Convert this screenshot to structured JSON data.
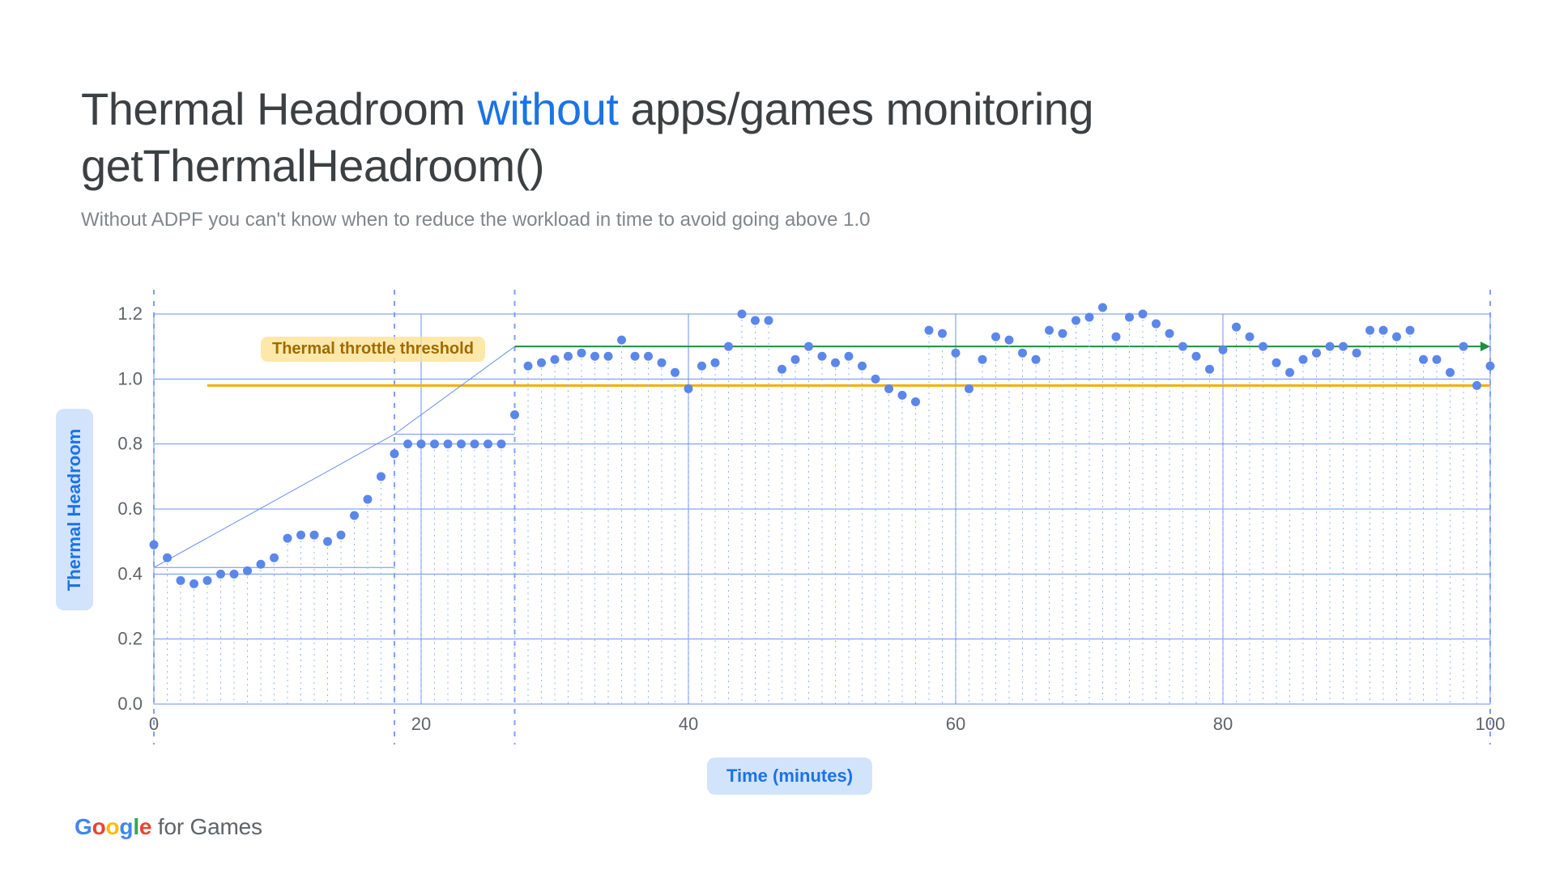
{
  "title": {
    "pre": "Thermal Headroom ",
    "accent": "without",
    "post": " apps/games monitoring getThermalHeadroom()"
  },
  "subtitle": "Without ADPF you can't know when to reduce the workload in time to avoid going above 1.0",
  "ylabel": "Thermal Headroom",
  "xlabel": "Time (minutes)",
  "annotation": "Thermal throttle threshold",
  "footer": {
    "logo": [
      "G",
      "o",
      "o",
      "g",
      "l",
      "e"
    ],
    "rest": " for Games"
  },
  "chart_data": {
    "type": "scatter",
    "title": "",
    "xlabel": "Time (minutes)",
    "ylabel": "Thermal Headroom",
    "xlim": [
      0,
      100
    ],
    "ylim": [
      0.0,
      1.2
    ],
    "x_ticks": [
      0,
      20,
      40,
      60,
      80,
      100
    ],
    "y_ticks": [
      0.0,
      0.2,
      0.4,
      0.6,
      0.8,
      1.0,
      1.2
    ],
    "threshold_line_y": 0.98,
    "plateau_arrow_y": 1.1,
    "dashed_vlines_x": [
      0,
      18,
      27,
      100
    ],
    "segment_brackets": [
      {
        "x0": 0,
        "x1": 18,
        "y": 0.42
      },
      {
        "x0": 18,
        "x1": 27,
        "y": 0.83
      }
    ],
    "x": [
      0,
      1,
      2,
      3,
      4,
      5,
      6,
      7,
      8,
      9,
      10,
      11,
      12,
      13,
      14,
      15,
      16,
      17,
      18,
      19,
      20,
      21,
      22,
      23,
      24,
      25,
      26,
      27,
      28,
      29,
      30,
      31,
      32,
      33,
      34,
      35,
      36,
      37,
      38,
      39,
      40,
      41,
      42,
      43,
      44,
      45,
      46,
      47,
      48,
      49,
      50,
      51,
      52,
      53,
      54,
      55,
      56,
      57,
      58,
      59,
      60,
      61,
      62,
      63,
      64,
      65,
      66,
      67,
      68,
      69,
      70,
      71,
      72,
      73,
      74,
      75,
      76,
      77,
      78,
      79,
      80,
      81,
      82,
      83,
      84,
      85,
      86,
      87,
      88,
      89,
      90,
      91,
      92,
      93,
      94,
      95,
      96,
      97,
      98,
      99,
      100
    ],
    "values": [
      0.49,
      0.45,
      0.38,
      0.37,
      0.38,
      0.4,
      0.4,
      0.41,
      0.43,
      0.45,
      0.51,
      0.52,
      0.52,
      0.5,
      0.52,
      0.58,
      0.63,
      0.7,
      0.77,
      0.8,
      0.8,
      0.8,
      0.8,
      0.8,
      0.8,
      0.8,
      0.8,
      0.89,
      1.04,
      1.05,
      1.06,
      1.07,
      1.08,
      1.07,
      1.07,
      1.12,
      1.07,
      1.07,
      1.05,
      1.02,
      0.97,
      1.04,
      1.05,
      1.1,
      1.2,
      1.18,
      1.18,
      1.03,
      1.06,
      1.1,
      1.07,
      1.05,
      1.07,
      1.04,
      1.0,
      0.97,
      0.95,
      0.93,
      1.15,
      1.14,
      1.08,
      0.97,
      1.06,
      1.13,
      1.12,
      1.08,
      1.06,
      1.15,
      1.14,
      1.18,
      1.19,
      1.22,
      1.13,
      1.19,
      1.2,
      1.17,
      1.14,
      1.1,
      1.07,
      1.03,
      1.09,
      1.16,
      1.13,
      1.1,
      1.05,
      1.02,
      1.06,
      1.08,
      1.1,
      1.1,
      1.08,
      1.15,
      1.15,
      1.13,
      1.15,
      1.06,
      1.06,
      1.02,
      1.1,
      0.98,
      1.04
    ]
  }
}
